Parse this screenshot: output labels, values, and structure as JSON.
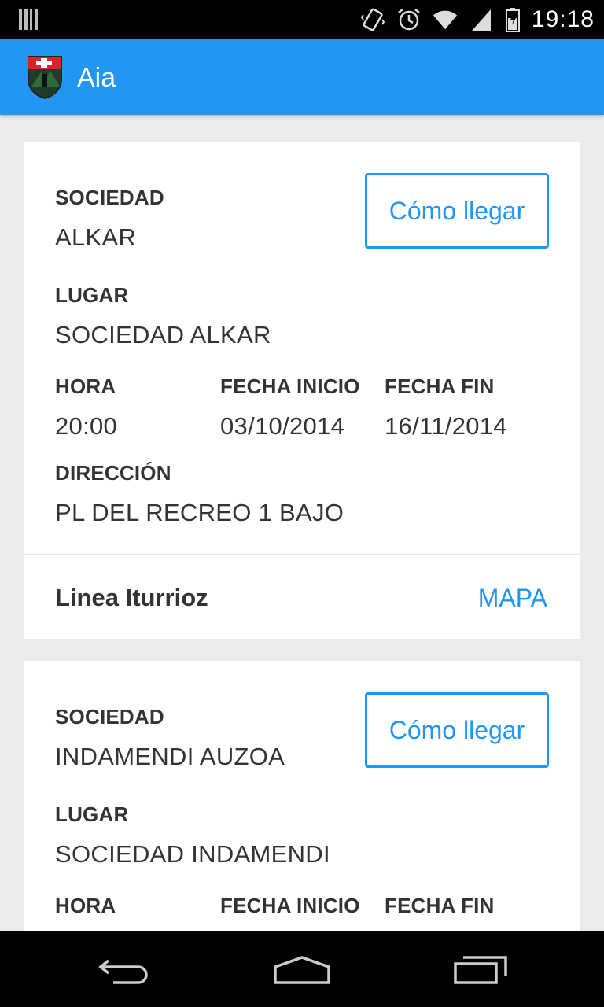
{
  "status_bar": {
    "time": "19:18",
    "icons": [
      "storage-icon",
      "vibrate-icon",
      "alarm-icon",
      "wifi-icon",
      "signal-icon",
      "battery-icon"
    ]
  },
  "app_bar": {
    "title": "Aia",
    "logo": "aia-coat-of-arms-icon",
    "color": "#2196F3"
  },
  "cards": [
    {
      "sociedad_label": "SOCIEDAD",
      "sociedad": "ALKAR",
      "button_label": "Cómo llegar",
      "lugar_label": "LUGAR",
      "lugar": "SOCIEDAD ALKAR",
      "hora_label": "HORA",
      "hora": "20:00",
      "fecha_inicio_label": "FECHA INICIO",
      "fecha_inicio": "03/10/2014",
      "fecha_fin_label": "FECHA FIN",
      "fecha_fin": "16/11/2014",
      "direccion_label": "DIRECCIÓN",
      "direccion": "PL DEL RECREO 1 BAJO",
      "linea": "Linea Iturrioz",
      "mapa_label": "MAPA"
    },
    {
      "sociedad_label": "SOCIEDAD",
      "sociedad": "INDAMENDI AUZOA",
      "button_label": "Cómo llegar",
      "lugar_label": "LUGAR",
      "lugar": "SOCIEDAD INDAMENDI",
      "hora_label": "HORA",
      "fecha_inicio_label": "FECHA INICIO",
      "fecha_fin_label": "FECHA FIN"
    }
  ],
  "nav_bar": {
    "buttons": [
      "back-icon",
      "home-icon",
      "recent-apps-icon"
    ]
  }
}
